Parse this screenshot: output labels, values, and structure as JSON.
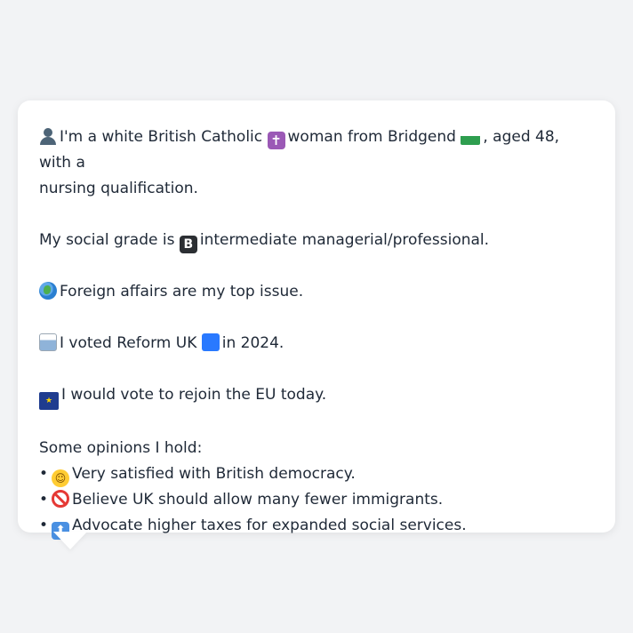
{
  "profile": {
    "intro_emoji": "person-icon",
    "intro_a": "I'm a white British Catholic",
    "intro_b": "woman from Bridgend",
    "intro_c": ", aged 48, with a",
    "intro_d": "nursing qualification.",
    "grade_a": "My social grade is",
    "grade_b": "intermediate managerial/professional.",
    "issue": "Foreign affairs are my top issue.",
    "vote_a": "I voted Reform UK",
    "vote_b": "in 2024.",
    "eu": "I would vote to rejoin the EU today.",
    "opinions_header": "Some opinions I hold:",
    "opinions": [
      "Very satisfied with British democracy.",
      "Believe UK should allow many fewer immigrants.",
      "Advocate higher taxes for expanded social services."
    ]
  },
  "glyphs": {
    "cross": "✝",
    "b": "B",
    "eu": "★",
    "smile": "☺",
    "up": "⬆",
    "bullet": "•",
    "dragon": "🐉"
  },
  "colors": {
    "background": "#f2f3f5",
    "bubble": "#ffffff",
    "text": "#1f2937"
  }
}
